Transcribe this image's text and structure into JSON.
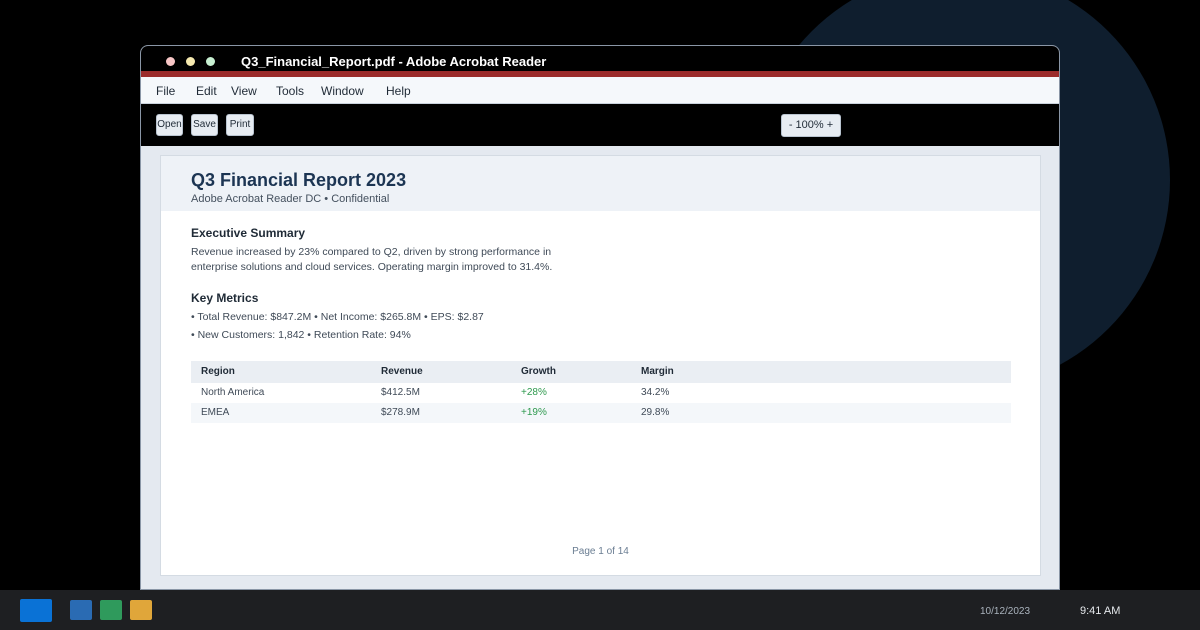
{
  "window": {
    "title": "Q3_Financial_Report.pdf - Adobe Acrobat Reader"
  },
  "menu": {
    "items": [
      "File",
      "Edit",
      "View",
      "Tools",
      "Window",
      "Help"
    ]
  },
  "toolbar": {
    "open_label": "Open",
    "save_label": "Save",
    "print_label": "Print",
    "zoom_out": "-",
    "zoom_level": "100%",
    "zoom_in": "+"
  },
  "document": {
    "title": "Q3 Financial Report 2023",
    "subtitle": "Adobe Acrobat Reader DC • Confidential",
    "executive_summary": {
      "heading": "Executive Summary",
      "line1": "Revenue increased by 23% compared to Q2, driven by strong performance in",
      "line2": "enterprise solutions and cloud services. Operating margin improved to 31.4%."
    },
    "key_metrics": {
      "heading": "Key Metrics",
      "line1": "• Total Revenue: $847.2M • Net Income: $265.8M • EPS: $2.87",
      "line2": "• New Customers: 1,842 • Retention Rate: 94%"
    },
    "table": {
      "headers": [
        "Region",
        "Revenue",
        "Growth",
        "Margin"
      ],
      "rows": [
        [
          "North America",
          "$412.5M",
          "+28%",
          "34.2%"
        ],
        [
          "EMEA",
          "$278.9M",
          "+19%",
          "29.8%"
        ]
      ]
    },
    "footer": "Page 1 of 14"
  },
  "taskbar": {
    "date": "10/12/2023",
    "time": "9:41 AM",
    "apps": [
      {
        "name": "app-blue",
        "color": "#2a6bb3"
      },
      {
        "name": "app-green",
        "color": "#2f9a5c"
      },
      {
        "name": "app-orange",
        "color": "#e0a63a"
      }
    ]
  },
  "colors": {
    "accent": "#9b2b2b",
    "title": "#1c3553",
    "growth": "#2e9a4e",
    "start": "#0a72d6"
  }
}
